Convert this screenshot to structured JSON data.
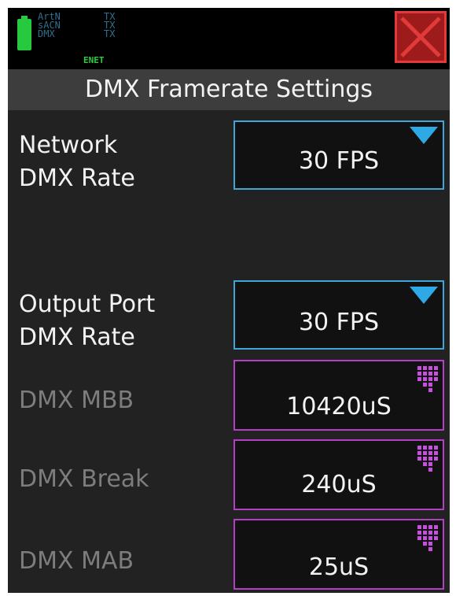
{
  "status": {
    "protocols": [
      "ArtN",
      "sACN",
      "DMX"
    ],
    "tx": [
      "TX",
      "TX",
      "TX"
    ],
    "enet": "ENET"
  },
  "header": {
    "title": "DMX Framerate Settings"
  },
  "settings": {
    "network_rate": {
      "label_line1": "Network",
      "label_line2": "DMX Rate",
      "value": "30 FPS"
    },
    "output_rate": {
      "label_line1": "Output Port",
      "label_line2": "DMX Rate",
      "value": "30 FPS"
    },
    "mbb": {
      "label": "DMX MBB",
      "value": "10420uS"
    },
    "break": {
      "label": "DMX Break",
      "value": "240uS"
    },
    "mab": {
      "label": "DMX MAB",
      "value": "25uS"
    }
  },
  "colors": {
    "dropdown_border": "#3ea7d9",
    "keypad_border": "#b23fc4",
    "close_button": "#9e1b1b",
    "battery": "#27c93f"
  },
  "icons": {
    "close": "close-icon",
    "dropdown": "dropdown-triangle-icon",
    "keypad": "keypad-icon",
    "battery": "battery-icon"
  }
}
